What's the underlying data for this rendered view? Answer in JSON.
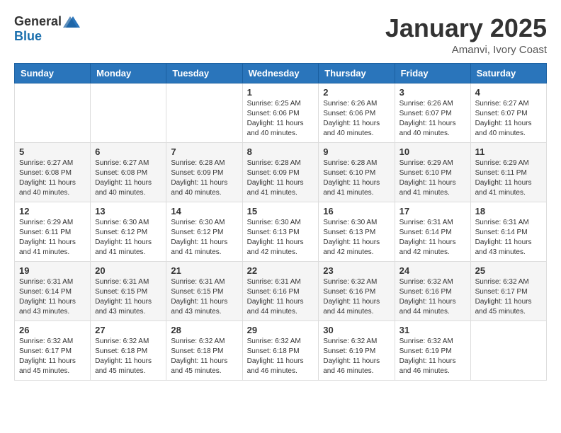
{
  "header": {
    "logo_general": "General",
    "logo_blue": "Blue",
    "month_year": "January 2025",
    "location": "Amanvi, Ivory Coast"
  },
  "weekdays": [
    "Sunday",
    "Monday",
    "Tuesday",
    "Wednesday",
    "Thursday",
    "Friday",
    "Saturday"
  ],
  "weeks": [
    [
      {
        "day": "",
        "info": ""
      },
      {
        "day": "",
        "info": ""
      },
      {
        "day": "",
        "info": ""
      },
      {
        "day": "1",
        "info": "Sunrise: 6:25 AM\nSunset: 6:06 PM\nDaylight: 11 hours and 40 minutes."
      },
      {
        "day": "2",
        "info": "Sunrise: 6:26 AM\nSunset: 6:06 PM\nDaylight: 11 hours and 40 minutes."
      },
      {
        "day": "3",
        "info": "Sunrise: 6:26 AM\nSunset: 6:07 PM\nDaylight: 11 hours and 40 minutes."
      },
      {
        "day": "4",
        "info": "Sunrise: 6:27 AM\nSunset: 6:07 PM\nDaylight: 11 hours and 40 minutes."
      }
    ],
    [
      {
        "day": "5",
        "info": "Sunrise: 6:27 AM\nSunset: 6:08 PM\nDaylight: 11 hours and 40 minutes."
      },
      {
        "day": "6",
        "info": "Sunrise: 6:27 AM\nSunset: 6:08 PM\nDaylight: 11 hours and 40 minutes."
      },
      {
        "day": "7",
        "info": "Sunrise: 6:28 AM\nSunset: 6:09 PM\nDaylight: 11 hours and 40 minutes."
      },
      {
        "day": "8",
        "info": "Sunrise: 6:28 AM\nSunset: 6:09 PM\nDaylight: 11 hours and 41 minutes."
      },
      {
        "day": "9",
        "info": "Sunrise: 6:28 AM\nSunset: 6:10 PM\nDaylight: 11 hours and 41 minutes."
      },
      {
        "day": "10",
        "info": "Sunrise: 6:29 AM\nSunset: 6:10 PM\nDaylight: 11 hours and 41 minutes."
      },
      {
        "day": "11",
        "info": "Sunrise: 6:29 AM\nSunset: 6:11 PM\nDaylight: 11 hours and 41 minutes."
      }
    ],
    [
      {
        "day": "12",
        "info": "Sunrise: 6:29 AM\nSunset: 6:11 PM\nDaylight: 11 hours and 41 minutes."
      },
      {
        "day": "13",
        "info": "Sunrise: 6:30 AM\nSunset: 6:12 PM\nDaylight: 11 hours and 41 minutes."
      },
      {
        "day": "14",
        "info": "Sunrise: 6:30 AM\nSunset: 6:12 PM\nDaylight: 11 hours and 41 minutes."
      },
      {
        "day": "15",
        "info": "Sunrise: 6:30 AM\nSunset: 6:13 PM\nDaylight: 11 hours and 42 minutes."
      },
      {
        "day": "16",
        "info": "Sunrise: 6:30 AM\nSunset: 6:13 PM\nDaylight: 11 hours and 42 minutes."
      },
      {
        "day": "17",
        "info": "Sunrise: 6:31 AM\nSunset: 6:14 PM\nDaylight: 11 hours and 42 minutes."
      },
      {
        "day": "18",
        "info": "Sunrise: 6:31 AM\nSunset: 6:14 PM\nDaylight: 11 hours and 43 minutes."
      }
    ],
    [
      {
        "day": "19",
        "info": "Sunrise: 6:31 AM\nSunset: 6:14 PM\nDaylight: 11 hours and 43 minutes."
      },
      {
        "day": "20",
        "info": "Sunrise: 6:31 AM\nSunset: 6:15 PM\nDaylight: 11 hours and 43 minutes."
      },
      {
        "day": "21",
        "info": "Sunrise: 6:31 AM\nSunset: 6:15 PM\nDaylight: 11 hours and 43 minutes."
      },
      {
        "day": "22",
        "info": "Sunrise: 6:31 AM\nSunset: 6:16 PM\nDaylight: 11 hours and 44 minutes."
      },
      {
        "day": "23",
        "info": "Sunrise: 6:32 AM\nSunset: 6:16 PM\nDaylight: 11 hours and 44 minutes."
      },
      {
        "day": "24",
        "info": "Sunrise: 6:32 AM\nSunset: 6:16 PM\nDaylight: 11 hours and 44 minutes."
      },
      {
        "day": "25",
        "info": "Sunrise: 6:32 AM\nSunset: 6:17 PM\nDaylight: 11 hours and 45 minutes."
      }
    ],
    [
      {
        "day": "26",
        "info": "Sunrise: 6:32 AM\nSunset: 6:17 PM\nDaylight: 11 hours and 45 minutes."
      },
      {
        "day": "27",
        "info": "Sunrise: 6:32 AM\nSunset: 6:18 PM\nDaylight: 11 hours and 45 minutes."
      },
      {
        "day": "28",
        "info": "Sunrise: 6:32 AM\nSunset: 6:18 PM\nDaylight: 11 hours and 45 minutes."
      },
      {
        "day": "29",
        "info": "Sunrise: 6:32 AM\nSunset: 6:18 PM\nDaylight: 11 hours and 46 minutes."
      },
      {
        "day": "30",
        "info": "Sunrise: 6:32 AM\nSunset: 6:19 PM\nDaylight: 11 hours and 46 minutes."
      },
      {
        "day": "31",
        "info": "Sunrise: 6:32 AM\nSunset: 6:19 PM\nDaylight: 11 hours and 46 minutes."
      },
      {
        "day": "",
        "info": ""
      }
    ]
  ]
}
